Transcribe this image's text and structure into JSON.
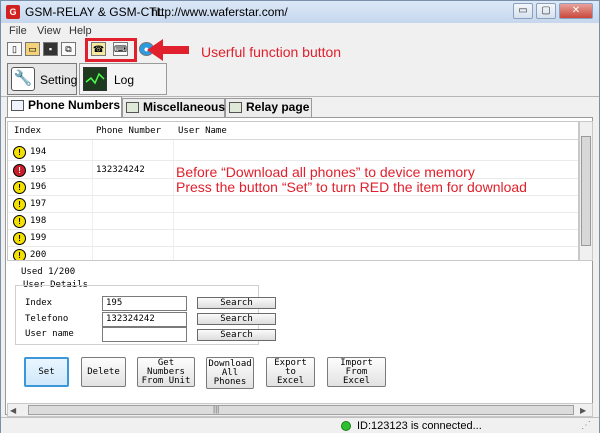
{
  "window": {
    "title": "GSM-RELAY & GSM-CTL",
    "url": "http://www.waferstar.com/",
    "controls": {
      "minimize": "▭",
      "maximize": "▢",
      "close": "✕"
    }
  },
  "menu": {
    "file": "File",
    "view": "View",
    "help": "Help"
  },
  "annotations": {
    "function_button": "Userful function button",
    "line1": "Before “Download all phones” to device memory",
    "line2": "Press the button “Set” to turn RED the item for download",
    "color": "#e0202c"
  },
  "big_tabs": {
    "setting": "Setting",
    "log": "Log"
  },
  "sub_tabs": {
    "phone_numbers": "Phone Numbers",
    "miscellaneous": "Miscellaneous",
    "relay_page": "Relay page"
  },
  "table": {
    "headers": [
      "Index",
      "Phone Number",
      "User Name"
    ],
    "rows": [
      {
        "index": "194",
        "phone": "",
        "user": "",
        "state": "yellow"
      },
      {
        "index": "195",
        "phone": "132324242",
        "user": "",
        "state": "red"
      },
      {
        "index": "196",
        "phone": "",
        "user": "",
        "state": "yellow"
      },
      {
        "index": "197",
        "phone": "",
        "user": "",
        "state": "yellow"
      },
      {
        "index": "198",
        "phone": "",
        "user": "",
        "state": "yellow"
      },
      {
        "index": "199",
        "phone": "",
        "user": "",
        "state": "yellow"
      },
      {
        "index": "200",
        "phone": "",
        "user": "",
        "state": "yellow"
      }
    ]
  },
  "details": {
    "used": "Used 1/200",
    "group_label": "User Details",
    "index_label": "Index",
    "index_value": "195",
    "telefono_label": "Telefono",
    "telefono_value": "132324242",
    "username_label": "User name",
    "username_value": "",
    "search": "Search"
  },
  "buttons": {
    "set": "Set",
    "delete": "Delete",
    "get_numbers": "Get Numbers\nFrom Unit",
    "download_all": "Download\nAll\nPhones",
    "export": "Export to\nExcel",
    "import": "Import From\nExcel"
  },
  "hscroll_grip": "|||",
  "status": {
    "text": "ID:123123 is connected...",
    "indicator_color": "#2fc02f"
  }
}
